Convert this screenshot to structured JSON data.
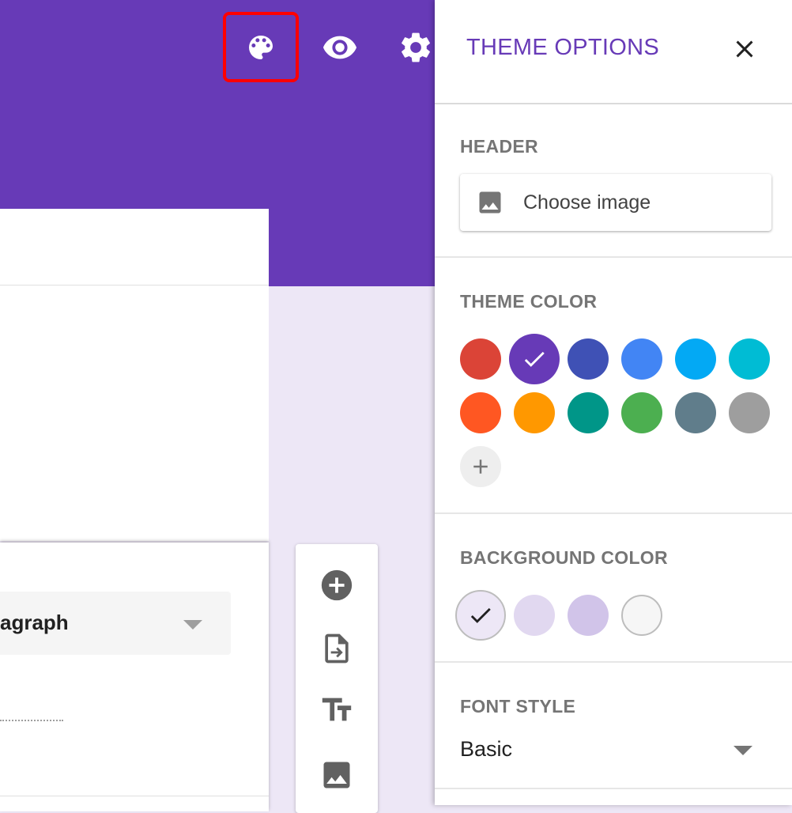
{
  "icons": {
    "palette": "palette-icon",
    "preview": "eye-icon",
    "settings": "gear-icon",
    "close": "close-icon",
    "image": "image-icon",
    "add_question": "add-circle-icon",
    "import": "import-icon",
    "title": "title-icon",
    "add_image": "image-icon",
    "add_custom_color": "plus-icon",
    "check": "check-icon"
  },
  "form": {
    "question_type": "agraph"
  },
  "panel": {
    "title": "THEME OPTIONS",
    "header": {
      "label": "HEADER",
      "choose_image": "Choose image"
    },
    "theme_color": {
      "label": "THEME COLOR",
      "selected": "#673ab7",
      "colors": [
        "#db4437",
        "#673ab7",
        "#3f51b5",
        "#4285f4",
        "#03a9f4",
        "#00bcd4",
        "#ff5722",
        "#ff9800",
        "#009688",
        "#4caf50",
        "#607d8b",
        "#9e9e9e"
      ]
    },
    "background_color": {
      "label": "BACKGROUND COLOR",
      "selected": "#ede7f6",
      "colors": [
        "#ede7f6",
        "#e1d8f0",
        "#d1c4e9",
        "#f6f6f6"
      ]
    },
    "font_style": {
      "label": "FONT STYLE",
      "value": "Basic"
    }
  },
  "colors": {
    "accent": "#673ab7",
    "highlight_box": "#ff0000"
  }
}
